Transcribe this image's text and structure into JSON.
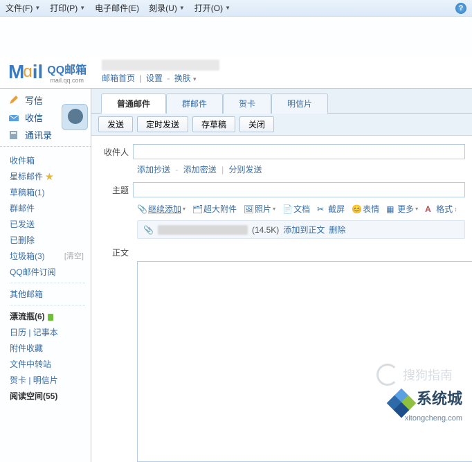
{
  "menubar": {
    "items": [
      {
        "label": "文件(F)"
      },
      {
        "label": "打印(P)"
      },
      {
        "label": "电子邮件(E)"
      },
      {
        "label": "刻录(U)"
      },
      {
        "label": "打开(O)"
      }
    ],
    "help_tooltip": "帮助"
  },
  "brand": {
    "cn_name": "QQ邮箱",
    "domain": "mail.qq.com"
  },
  "header": {
    "link_home": "邮箱首页",
    "link_settings": "设置",
    "link_skin": "换肤"
  },
  "sidebar": {
    "top": [
      {
        "label": "写信",
        "icon": "compose-icon"
      },
      {
        "label": "收信",
        "icon": "inbox-icon"
      },
      {
        "label": "通讯录",
        "icon": "contacts-icon"
      }
    ],
    "groups": [
      [
        {
          "label": "收件箱"
        },
        {
          "label": "星标邮件",
          "star": true
        },
        {
          "label": "草稿箱(1)"
        },
        {
          "label": "群邮件"
        },
        {
          "label": "已发送"
        },
        {
          "label": "已删除"
        },
        {
          "label": "垃圾箱(3)",
          "action": "[清空]"
        },
        {
          "label": "QQ邮件订阅"
        }
      ],
      [
        {
          "label": "其他邮箱"
        }
      ],
      [
        {
          "label": "漂流瓶(6)",
          "green": true,
          "bold": true
        },
        {
          "label": "日历 | 记事本"
        },
        {
          "label": "附件收藏"
        },
        {
          "label": "文件中转站"
        },
        {
          "label": "贺卡 | 明信片"
        },
        {
          "label": "阅读空间(55)",
          "bold": true
        }
      ]
    ]
  },
  "tabs": [
    {
      "label": "普通邮件",
      "active": true
    },
    {
      "label": "群邮件"
    },
    {
      "label": "贺卡"
    },
    {
      "label": "明信片"
    }
  ],
  "toolbar": [
    {
      "label": "发送"
    },
    {
      "label": "定时发送"
    },
    {
      "label": "存草稿"
    },
    {
      "label": "关闭"
    }
  ],
  "compose": {
    "to_label": "收件人",
    "cc_link": "添加抄送",
    "bcc_link": "添加密送",
    "sep_link": "分别发送",
    "subject_label": "主题",
    "body_label": "正文"
  },
  "editorbar": {
    "attach": "继续添加",
    "bigfile": "超大附件",
    "photo": "照片",
    "doc": "文档",
    "screenshot": "截屏",
    "emoji": "表情",
    "more": "更多",
    "format": "格式"
  },
  "attachment": {
    "size": "(14.5K)",
    "insert": "添加到正文",
    "delete": "删除"
  },
  "watermarks": {
    "sogou": "搜狗指南",
    "xtc_cn": "系统城",
    "xtc_url": "xitongcheng.com"
  }
}
